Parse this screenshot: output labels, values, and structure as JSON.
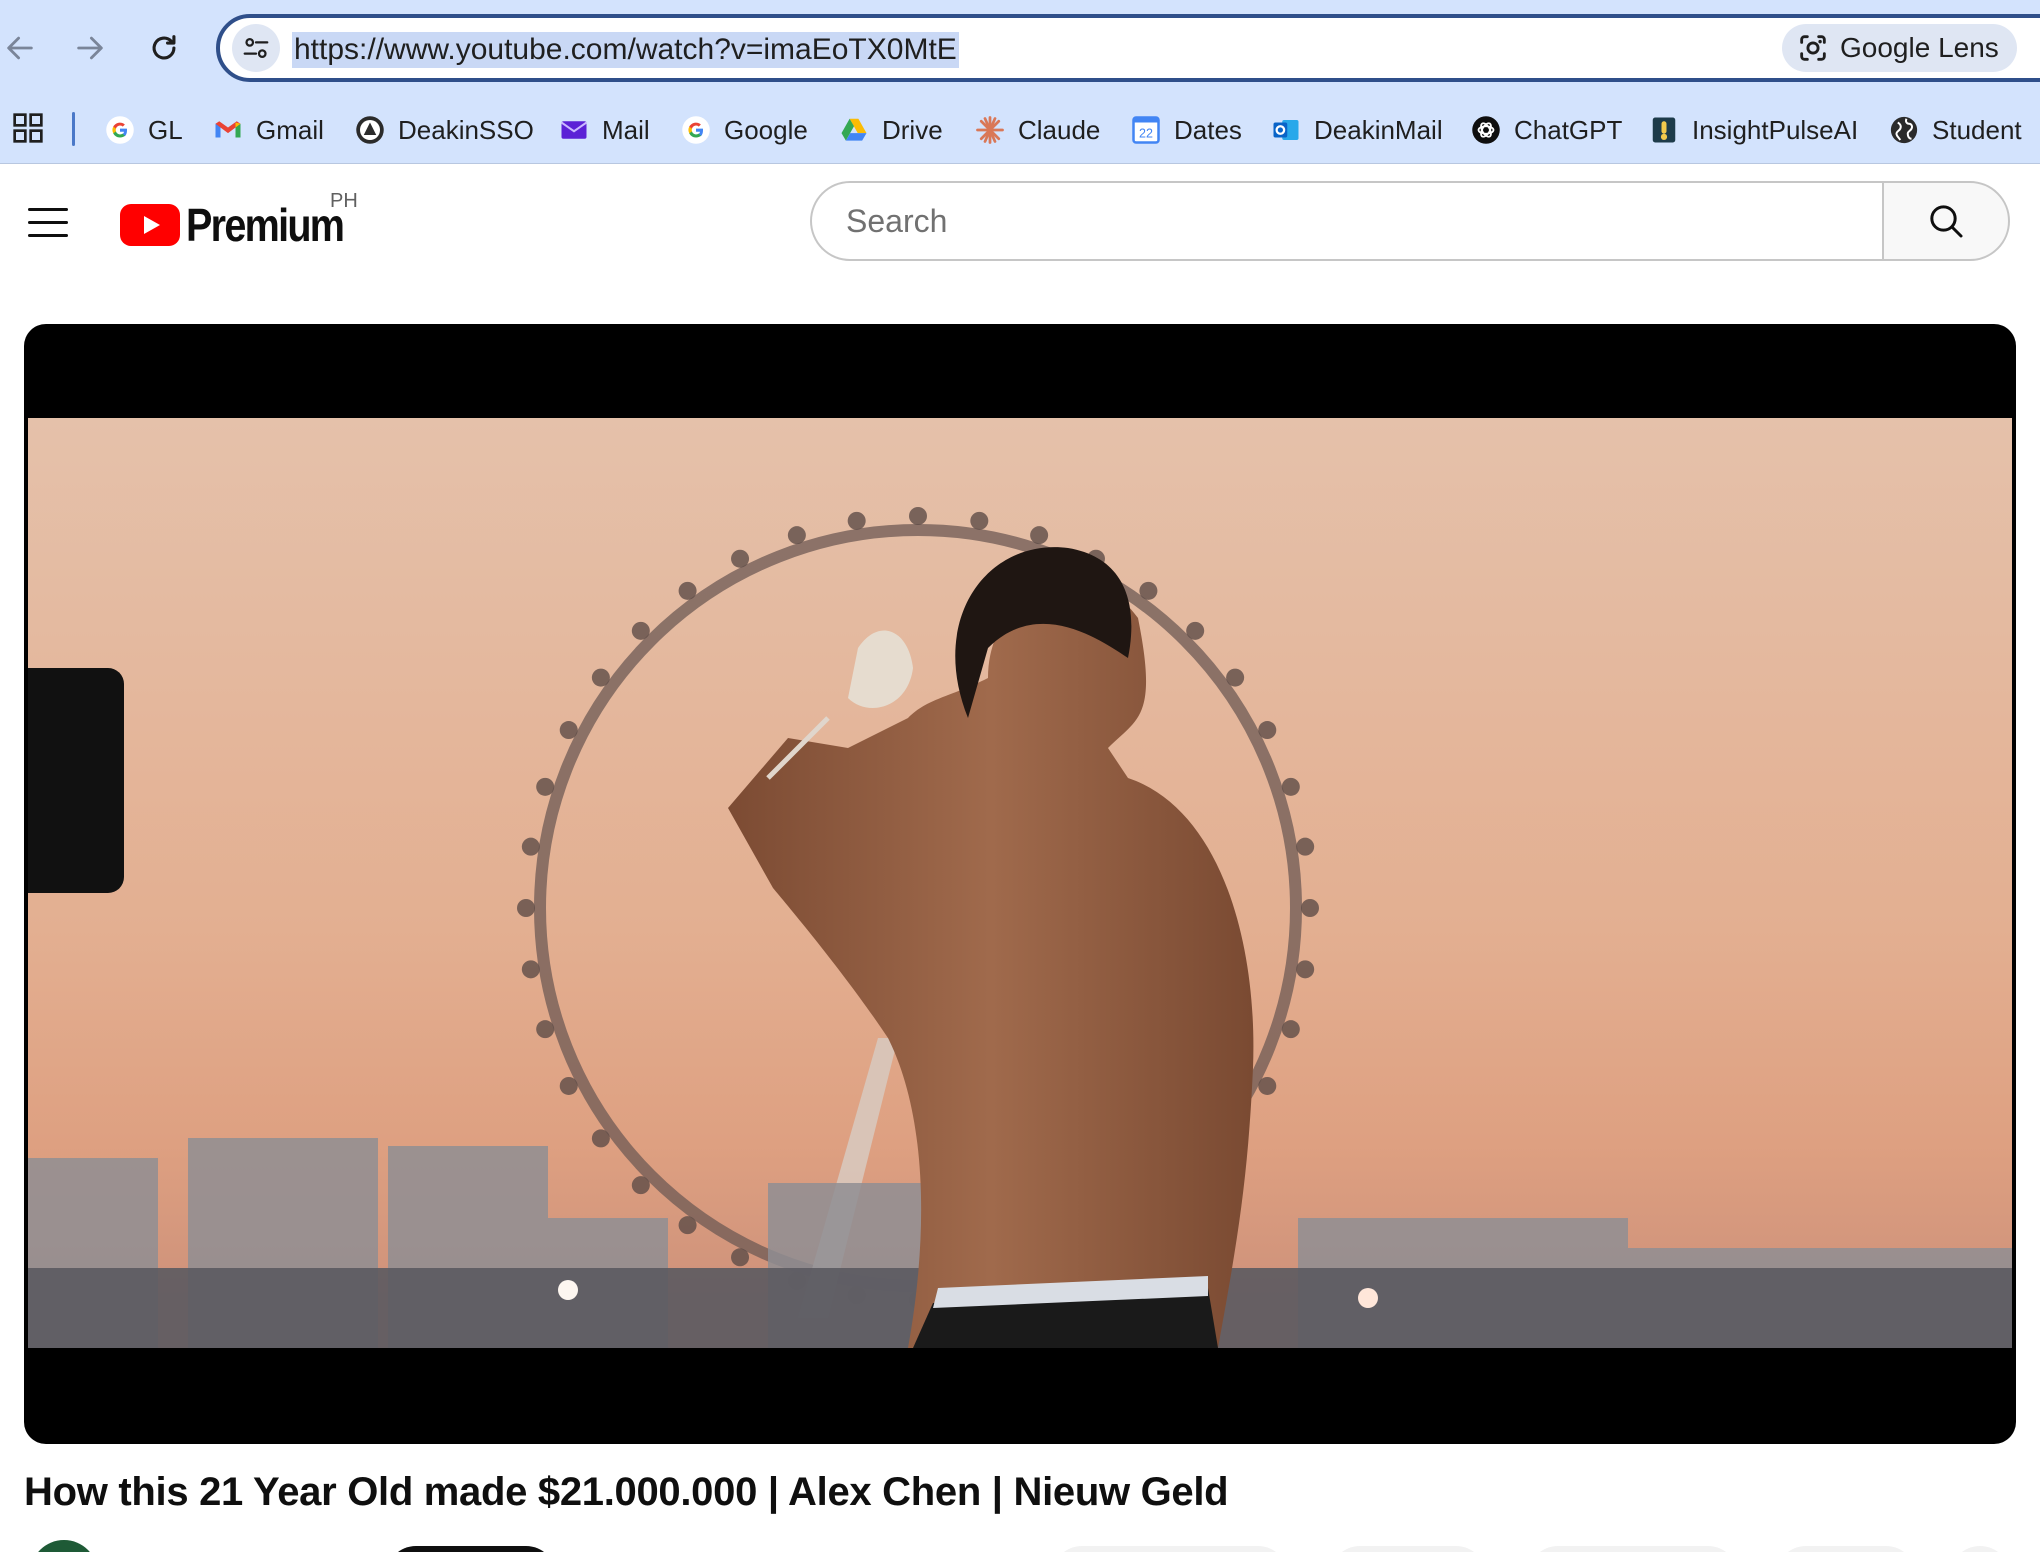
{
  "browser": {
    "url": "https://www.youtube.com/watch?v=imaEoTX0MtE",
    "lens_label": "Google Lens",
    "icons": {
      "back": "arrow-left-icon",
      "forward": "arrow-right-icon",
      "reload": "reload-icon",
      "site_info": "tune-icon",
      "lens": "camera-lens-icon",
      "apps": "apps-grid-icon"
    },
    "bookmarks": [
      {
        "label": "GL",
        "icon": "google-g-icon"
      },
      {
        "label": "Gmail",
        "icon": "gmail-icon"
      },
      {
        "label": "DeakinSSO",
        "icon": "deakin-icon"
      },
      {
        "label": "Mail",
        "icon": "mail-icon"
      },
      {
        "label": "Google",
        "icon": "google-g-icon"
      },
      {
        "label": "Drive",
        "icon": "drive-icon"
      },
      {
        "label": "Claude",
        "icon": "claude-icon"
      },
      {
        "label": "Dates",
        "icon": "calendar-icon"
      },
      {
        "label": "DeakinMail",
        "icon": "outlook-icon"
      },
      {
        "label": "ChatGPT",
        "icon": "chatgpt-icon"
      },
      {
        "label": "InsightPulseAI",
        "icon": "insightpulse-icon"
      },
      {
        "label": "Student",
        "icon": "globe-icon"
      }
    ]
  },
  "youtube": {
    "logo_text": "Premium",
    "country_code": "PH",
    "search_placeholder": "Search",
    "brand_color": "#ff0000",
    "icons": {
      "menu": "hamburger-menu-icon",
      "logo": "youtube-play-icon",
      "search": "search-icon"
    }
  },
  "video": {
    "title": "How this 21 Year Old made $21.000.000 | Alex Chen | Nieuw Geld",
    "frame_description_icon": "video-frame"
  }
}
